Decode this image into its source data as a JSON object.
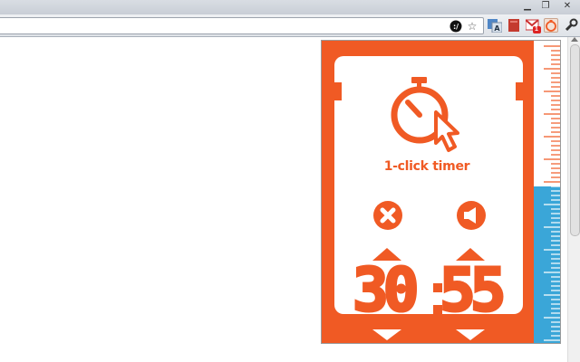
{
  "browser": {
    "window_controls": {
      "minimize": "▁",
      "restore": "❐",
      "close": "✕"
    },
    "omnibox": {
      "url": ""
    },
    "extensions": [
      {
        "name": "translate",
        "badge": ""
      },
      {
        "name": "bookmark",
        "badge": ""
      },
      {
        "name": "gmail",
        "badge": "1"
      },
      {
        "name": "one-click-timer",
        "badge": ""
      }
    ]
  },
  "popup": {
    "title": "1-click timer",
    "minutes": "30",
    "seconds": "55",
    "gauge": {
      "fill_fraction": 0.52,
      "fill_color": "#3aa6d8",
      "empty_color": "#ffffff"
    },
    "colors": {
      "accent": "#f05a24",
      "panel": "#ffffff"
    },
    "icons": {
      "stopwatch": "stopwatch-cursor-icon",
      "cancel": "close-icon",
      "sound": "speaker-icon",
      "increase": "triangle-up-icon",
      "decrease": "triangle-down-icon"
    }
  }
}
